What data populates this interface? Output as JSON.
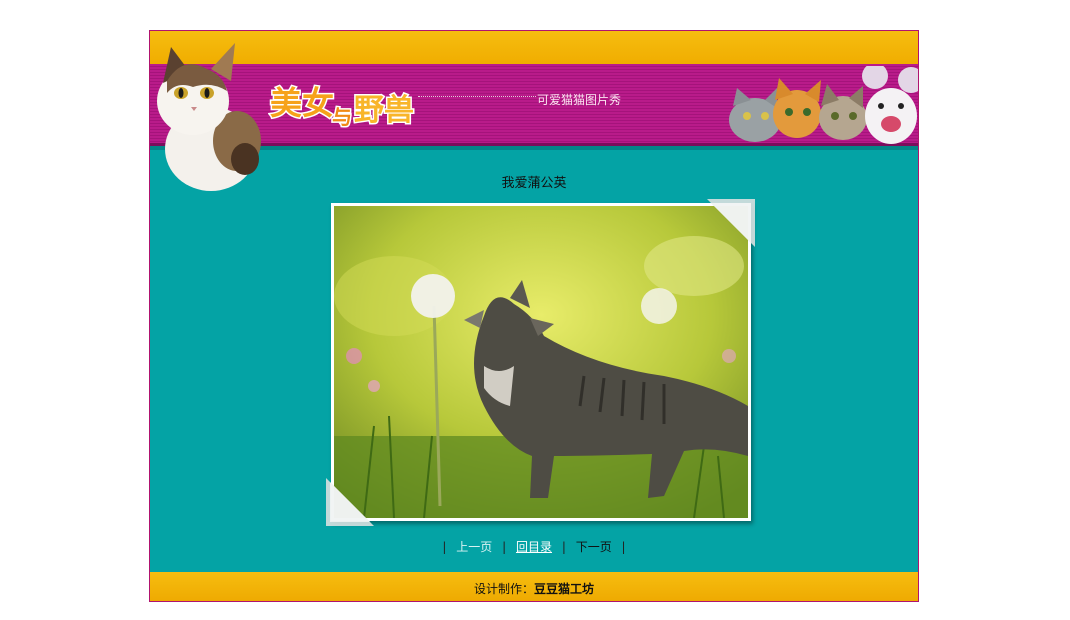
{
  "header": {
    "logo_text": "美女与野兽",
    "slogan": "可爱猫猫图片秀"
  },
  "photo": {
    "title": "我爱蒲公英"
  },
  "pager": {
    "prev": "上一页",
    "toc": "回目录",
    "next": "下一页",
    "separator": "|"
  },
  "footer": {
    "label": "设计制作：",
    "author": "豆豆猫工坊"
  },
  "colors": {
    "teal": "#04a3a5",
    "magenta": "#b91b8a",
    "orange": "#f0ad00",
    "border": "#b0136f"
  },
  "icons": {
    "logo": "site-logo",
    "mascot": "calico-cat-mascot",
    "header_cats": "cats-and-mouse-group"
  }
}
